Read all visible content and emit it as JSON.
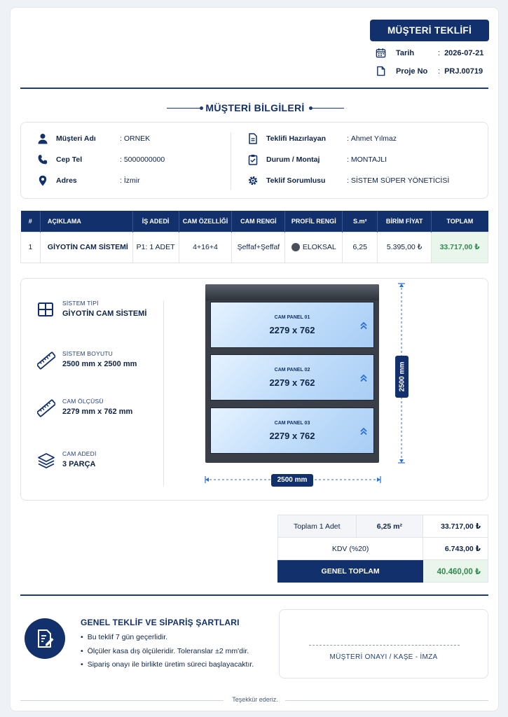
{
  "header": {
    "title": "MÜŞTERİ TEKLİFİ",
    "date_label": "Tarih",
    "date_value": "2026-07-21",
    "project_label": "Proje No",
    "project_value": "PRJ.00719",
    "icons": [
      "calendar-icon",
      "document-icon"
    ]
  },
  "customer_section": {
    "title": "MÜŞTERİ BİLGİLERİ",
    "left": [
      {
        "label": "Müşteri Adı",
        "value": "ORNEK",
        "icon": "user-icon"
      },
      {
        "label": "Cep Tel",
        "value": "5000000000",
        "icon": "phone-icon"
      },
      {
        "label": "Adres",
        "value": "İzmir",
        "icon": "location-pin-icon"
      }
    ],
    "right": [
      {
        "label": "Teklifi Hazırlayan",
        "value": "Ahmet Yılmaz",
        "icon": "document-text-icon"
      },
      {
        "label": "Durum / Montaj",
        "value": "MONTAJLI",
        "icon": "clipboard-check-icon"
      },
      {
        "label": "Teklif Sorumlusu",
        "value": "SİSTEM SÜPER YÖNETİCİSİ",
        "icon": "gear-icon"
      }
    ]
  },
  "items_table": {
    "columns": [
      "#",
      "AÇIKLAMA",
      "İŞ ADEDİ",
      "CAM ÖZELLİĞİ",
      "CAM RENGİ",
      "PROFİL RENGİ",
      "S.m²",
      "BİRİM FİYAT",
      "TOPLAM"
    ],
    "rows": [
      {
        "no": "1",
        "description": "GİYOTİN CAM SİSTEMİ",
        "qty": "P1: 1 ADET",
        "glass_spec": "4+16+4",
        "glass_color": "Şeffaf+Şeffaf",
        "profile_color": "ELOKSAL",
        "profile_color_hex": "#4a4f57",
        "area": "6,25",
        "unit_price": "5.395,00 ₺",
        "total": "33.717,00 ₺"
      }
    ]
  },
  "system_specs": [
    {
      "label": "SİSTEM TİPİ",
      "value": "GİYOTİN CAM SİSTEMİ",
      "icon": "grid-icon"
    },
    {
      "label": "SİSTEM BOYUTU",
      "value": "2500 mm x 2500 mm",
      "icon": "ruler-icon"
    },
    {
      "label": "CAM ÖLÇÜSÜ",
      "value": "2279 mm x 762 mm",
      "icon": "ruler-icon"
    },
    {
      "label": "CAM ADEDİ",
      "value": "3 PARÇA",
      "icon": "layers-icon"
    }
  ],
  "diagram": {
    "panels": [
      {
        "label": "CAM PANEL 01",
        "size": "2279 x 762"
      },
      {
        "label": "CAM PANEL 02",
        "size": "2279 x 762"
      },
      {
        "label": "CAM PANEL 03",
        "size": "2279 x 762"
      }
    ],
    "height_label": "2500 mm",
    "width_label": "2500 mm"
  },
  "totals": {
    "subtotal_label": "Toplam 1 Adet",
    "subtotal_area": "6,25 m²",
    "subtotal_value": "33.717,00 ₺",
    "vat_label": "KDV (%20)",
    "vat_value": "6.743,00 ₺",
    "grand_label": "GENEL TOPLAM",
    "grand_value": "40.460,00 ₺"
  },
  "terms": {
    "title": "GENEL TEKLİF VE SİPARİŞ ŞARTLARI",
    "items": [
      "Bu teklif 7 gün geçerlidir.",
      "Ölçüler kasa dış ölçüleridir. Toleranslar ±2 mm'dir.",
      "Sipariş onayı ile birlikte üretim süreci başlayacaktır."
    ]
  },
  "signature_label": "MÜŞTERİ ONAYI / KAŞE - İMZA",
  "footer": "Teşekkür ederiz.",
  "colors": {
    "navy": "#12306b",
    "green": "#2e8a4e",
    "green_bg": "#eaf6ec"
  }
}
